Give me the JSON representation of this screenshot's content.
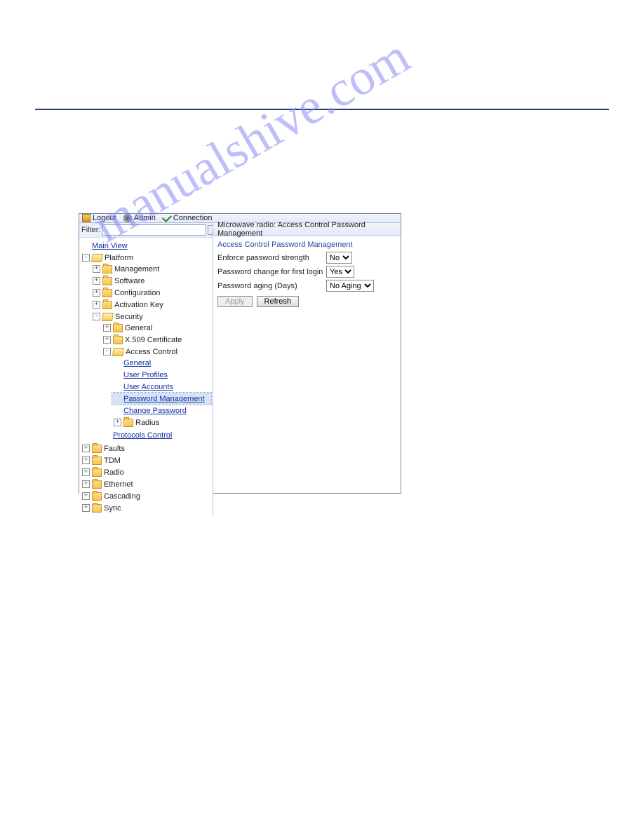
{
  "watermark": "manualshive.com",
  "toolbar": {
    "logout": "Logout",
    "admin": "Admin",
    "connection": "Connection"
  },
  "sidebar": {
    "filter_label": "Filter:",
    "filter_value": "",
    "filter_clear": "x",
    "main_view": "Main View",
    "platform": "Platform",
    "platform_children": {
      "management": "Management",
      "software": "Software",
      "configuration": "Configuration",
      "activation_key": "Activation Key",
      "security": "Security",
      "security_children": {
        "general": "General",
        "x509": "X.509 Certificate",
        "access_control": "Access Control",
        "ac_children": {
          "general": "General",
          "user_profiles": "User Profiles",
          "user_accounts": "User Accounts",
          "password_management": "Password Management",
          "change_password": "Change Password",
          "radius": "Radius"
        },
        "protocols_control": "Protocols Control"
      }
    },
    "faults": "Faults",
    "tdm": "TDM",
    "radio": "Radio",
    "ethernet": "Ethernet",
    "cascading": "Cascading",
    "sync": "Sync"
  },
  "main": {
    "breadcrumb": "Microwave radio: Access Control Password Management",
    "section_title": "Access Control Password Management",
    "fields": {
      "enforce_strength": {
        "label": "Enforce password strength",
        "value": "No"
      },
      "first_login_change": {
        "label": "Password change for first login",
        "value": "Yes"
      },
      "aging": {
        "label": "Password aging (Days)",
        "value": "No Aging"
      }
    },
    "buttons": {
      "apply": "Apply",
      "refresh": "Refresh"
    }
  }
}
